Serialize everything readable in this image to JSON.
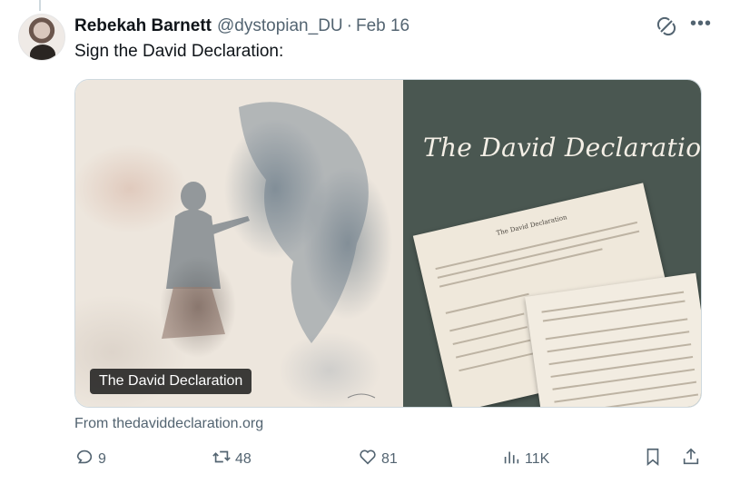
{
  "author": {
    "name": "Rebekah Barnett",
    "handle": "@dystopian_DU",
    "separator": "·",
    "date": "Feb 16"
  },
  "tweet": {
    "text": "Sign the David Declaration:"
  },
  "card": {
    "image_title": "The David Declaration",
    "paper_title": "The David Declaration",
    "caption": "The David Declaration",
    "source": "From thedaviddeclaration.org"
  },
  "actions": {
    "replies": "9",
    "retweets": "48",
    "likes": "81",
    "views": "11K"
  },
  "icons": {
    "reply": "reply-icon",
    "retweet": "retweet-icon",
    "like": "heart-icon",
    "views": "views-icon",
    "bookmark": "bookmark-icon",
    "share": "share-icon",
    "grok": "grok-icon",
    "more": "more-icon"
  },
  "colors": {
    "text_primary": "#0f1419",
    "text_secondary": "#536471",
    "card_right_bg": "#4a5751",
    "caption_bg": "#141414"
  }
}
